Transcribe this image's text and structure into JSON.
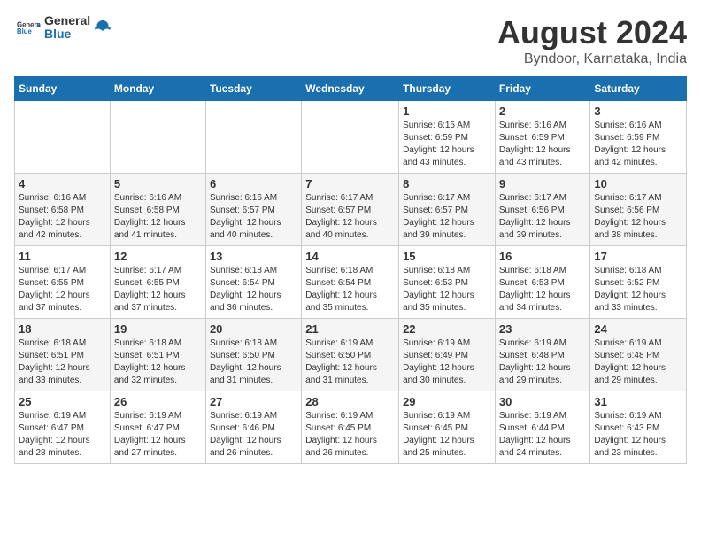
{
  "logo": {
    "general": "General",
    "blue": "Blue"
  },
  "title": "August 2024",
  "location": "Byndoor, Karnataka, India",
  "days_of_week": [
    "Sunday",
    "Monday",
    "Tuesday",
    "Wednesday",
    "Thursday",
    "Friday",
    "Saturday"
  ],
  "weeks": [
    [
      {
        "day": "",
        "info": ""
      },
      {
        "day": "",
        "info": ""
      },
      {
        "day": "",
        "info": ""
      },
      {
        "day": "",
        "info": ""
      },
      {
        "day": "1",
        "info": "Sunrise: 6:15 AM\nSunset: 6:59 PM\nDaylight: 12 hours\nand 43 minutes."
      },
      {
        "day": "2",
        "info": "Sunrise: 6:16 AM\nSunset: 6:59 PM\nDaylight: 12 hours\nand 43 minutes."
      },
      {
        "day": "3",
        "info": "Sunrise: 6:16 AM\nSunset: 6:59 PM\nDaylight: 12 hours\nand 42 minutes."
      }
    ],
    [
      {
        "day": "4",
        "info": "Sunrise: 6:16 AM\nSunset: 6:58 PM\nDaylight: 12 hours\nand 42 minutes."
      },
      {
        "day": "5",
        "info": "Sunrise: 6:16 AM\nSunset: 6:58 PM\nDaylight: 12 hours\nand 41 minutes."
      },
      {
        "day": "6",
        "info": "Sunrise: 6:16 AM\nSunset: 6:57 PM\nDaylight: 12 hours\nand 40 minutes."
      },
      {
        "day": "7",
        "info": "Sunrise: 6:17 AM\nSunset: 6:57 PM\nDaylight: 12 hours\nand 40 minutes."
      },
      {
        "day": "8",
        "info": "Sunrise: 6:17 AM\nSunset: 6:57 PM\nDaylight: 12 hours\nand 39 minutes."
      },
      {
        "day": "9",
        "info": "Sunrise: 6:17 AM\nSunset: 6:56 PM\nDaylight: 12 hours\nand 39 minutes."
      },
      {
        "day": "10",
        "info": "Sunrise: 6:17 AM\nSunset: 6:56 PM\nDaylight: 12 hours\nand 38 minutes."
      }
    ],
    [
      {
        "day": "11",
        "info": "Sunrise: 6:17 AM\nSunset: 6:55 PM\nDaylight: 12 hours\nand 37 minutes."
      },
      {
        "day": "12",
        "info": "Sunrise: 6:17 AM\nSunset: 6:55 PM\nDaylight: 12 hours\nand 37 minutes."
      },
      {
        "day": "13",
        "info": "Sunrise: 6:18 AM\nSunset: 6:54 PM\nDaylight: 12 hours\nand 36 minutes."
      },
      {
        "day": "14",
        "info": "Sunrise: 6:18 AM\nSunset: 6:54 PM\nDaylight: 12 hours\nand 35 minutes."
      },
      {
        "day": "15",
        "info": "Sunrise: 6:18 AM\nSunset: 6:53 PM\nDaylight: 12 hours\nand 35 minutes."
      },
      {
        "day": "16",
        "info": "Sunrise: 6:18 AM\nSunset: 6:53 PM\nDaylight: 12 hours\nand 34 minutes."
      },
      {
        "day": "17",
        "info": "Sunrise: 6:18 AM\nSunset: 6:52 PM\nDaylight: 12 hours\nand 33 minutes."
      }
    ],
    [
      {
        "day": "18",
        "info": "Sunrise: 6:18 AM\nSunset: 6:51 PM\nDaylight: 12 hours\nand 33 minutes."
      },
      {
        "day": "19",
        "info": "Sunrise: 6:18 AM\nSunset: 6:51 PM\nDaylight: 12 hours\nand 32 minutes."
      },
      {
        "day": "20",
        "info": "Sunrise: 6:18 AM\nSunset: 6:50 PM\nDaylight: 12 hours\nand 31 minutes."
      },
      {
        "day": "21",
        "info": "Sunrise: 6:19 AM\nSunset: 6:50 PM\nDaylight: 12 hours\nand 31 minutes."
      },
      {
        "day": "22",
        "info": "Sunrise: 6:19 AM\nSunset: 6:49 PM\nDaylight: 12 hours\nand 30 minutes."
      },
      {
        "day": "23",
        "info": "Sunrise: 6:19 AM\nSunset: 6:48 PM\nDaylight: 12 hours\nand 29 minutes."
      },
      {
        "day": "24",
        "info": "Sunrise: 6:19 AM\nSunset: 6:48 PM\nDaylight: 12 hours\nand 29 minutes."
      }
    ],
    [
      {
        "day": "25",
        "info": "Sunrise: 6:19 AM\nSunset: 6:47 PM\nDaylight: 12 hours\nand 28 minutes."
      },
      {
        "day": "26",
        "info": "Sunrise: 6:19 AM\nSunset: 6:47 PM\nDaylight: 12 hours\nand 27 minutes."
      },
      {
        "day": "27",
        "info": "Sunrise: 6:19 AM\nSunset: 6:46 PM\nDaylight: 12 hours\nand 26 minutes."
      },
      {
        "day": "28",
        "info": "Sunrise: 6:19 AM\nSunset: 6:45 PM\nDaylight: 12 hours\nand 26 minutes."
      },
      {
        "day": "29",
        "info": "Sunrise: 6:19 AM\nSunset: 6:45 PM\nDaylight: 12 hours\nand 25 minutes."
      },
      {
        "day": "30",
        "info": "Sunrise: 6:19 AM\nSunset: 6:44 PM\nDaylight: 12 hours\nand 24 minutes."
      },
      {
        "day": "31",
        "info": "Sunrise: 6:19 AM\nSunset: 6:43 PM\nDaylight: 12 hours\nand 23 minutes."
      }
    ]
  ]
}
